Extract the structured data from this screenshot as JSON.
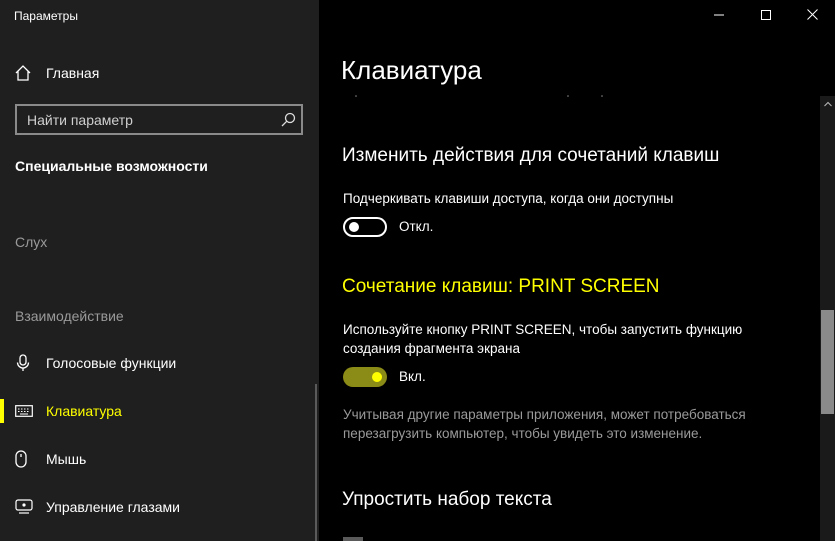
{
  "window": {
    "title": "Параметры",
    "controls": {
      "minimize": "minimize-icon",
      "maximize": "maximize-icon",
      "close": "close-icon"
    }
  },
  "sidebar": {
    "home_label": "Главная",
    "search_placeholder": "Найти параметр",
    "section_title": "Специальные возможности",
    "group_hearing": "Слух",
    "group_interaction": "Взаимодействие",
    "items": [
      {
        "label": "Голосовые функции",
        "icon": "microphone-icon"
      },
      {
        "label": "Клавиатура",
        "icon": "keyboard-icon",
        "active": true
      },
      {
        "label": "Мышь",
        "icon": "mouse-icon"
      },
      {
        "label": "Управление глазами",
        "icon": "eye-control-icon"
      }
    ]
  },
  "main": {
    "title": "Клавиатура",
    "section1": {
      "heading": "Изменить действия для сочетаний клавиш",
      "option_label": "Подчеркивать клавиши доступа, когда они доступны",
      "toggle_state": "Откл."
    },
    "section2": {
      "heading": "Сочетание клавиш: PRINT SCREEN",
      "desc_line1": "Используйте кнопку PRINT SCREEN, чтобы запустить функцию",
      "desc_line2": "создания фрагмента экрана",
      "toggle_state": "Вкл.",
      "note_line1": "Учитывая другие параметры приложения, может потребоваться",
      "note_line2": "перезагрузить компьютер, чтобы увидеть это изменение."
    },
    "section3": {
      "heading": "Упростить набор текста"
    }
  },
  "colors": {
    "accent": "#ffff00",
    "sidebar_bg": "#1f1f1f",
    "main_bg": "#000000",
    "toggle_on_track": "#8b8b17"
  }
}
